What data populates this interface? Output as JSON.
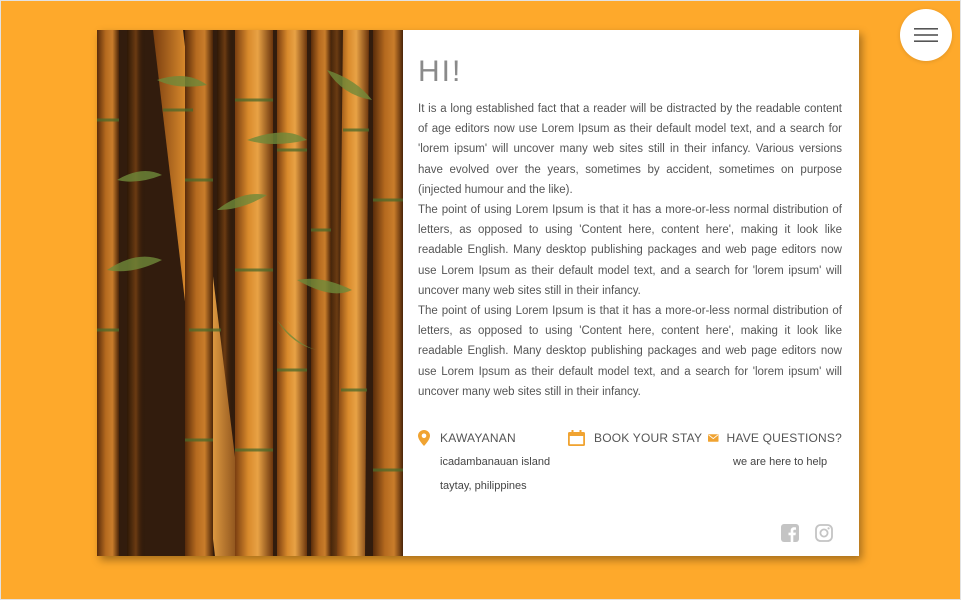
{
  "colors": {
    "background": "#fea92b",
    "accent": "#f0a331",
    "card": "#ffffff",
    "text": "#555555"
  },
  "menu": {
    "icon": "hamburger-menu-icon"
  },
  "hero": {
    "image": "bamboo-stalks-photo"
  },
  "content": {
    "greeting": "HI!",
    "paragraphs": [
      "It is a long established fact that a reader will be distracted by the readable content of age editors now use Lorem Ipsum as their default model text, and a search for 'lorem ipsum' will uncover many web sites still in their infancy. Various versions have evolved over the years, sometimes by accident, sometimes on purpose (injected humour and the like).",
      "The point of using Lorem Ipsum is that it has a more-or-less normal distribution of letters, as opposed to using 'Content here, content here', making it look like readable English. Many desktop publishing packages and web page editors now use Lorem Ipsum as their default model text, and a search for 'lorem ipsum' will uncover many web sites still in their infancy.",
      "The point of using Lorem Ipsum is that it has a more-or-less normal distribution of letters, as opposed to using 'Content here, content here', making it look like readable English. Many desktop publishing packages and web page editors now use Lorem Ipsum as their default model text, and a search for 'lorem ipsum' will uncover many web sites still in their infancy."
    ]
  },
  "info": {
    "location": {
      "icon": "map-pin-icon",
      "title": "KAWAYANAN",
      "line1": "icadambanauan island",
      "line2": "taytay, philippines"
    },
    "booking": {
      "icon": "calendar-icon",
      "title": "BOOK YOUR STAY"
    },
    "contact": {
      "icon": "envelope-icon",
      "title": "HAVE QUESTIONS?",
      "line1": "we are here to help"
    }
  },
  "social": [
    {
      "icon": "facebook-icon"
    },
    {
      "icon": "instagram-icon"
    }
  ]
}
